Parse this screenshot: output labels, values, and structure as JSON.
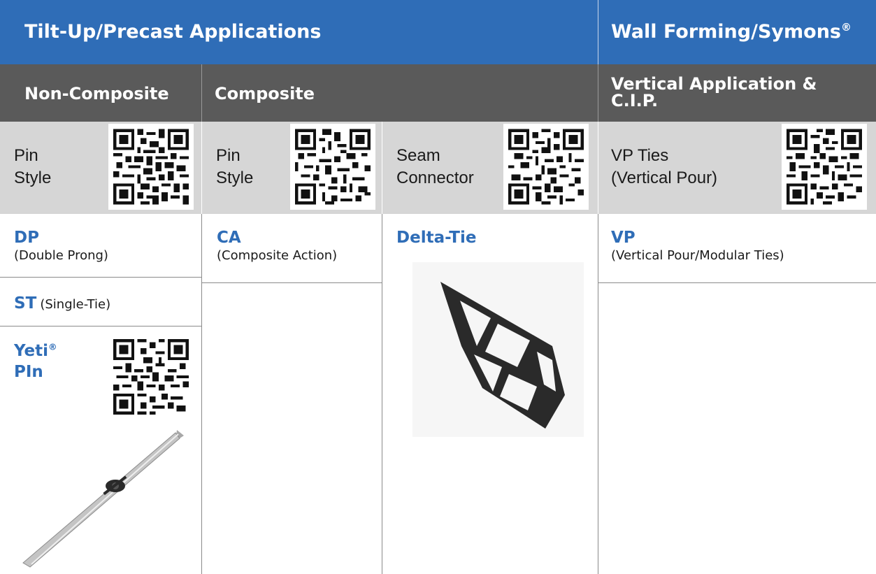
{
  "header": {
    "tiltup_title": "Tilt-Up/Precast Applications",
    "wallforming_title": "Wall Forming/Symons",
    "wallforming_reg": "®"
  },
  "subheader": {
    "noncomposite": "Non-Composite",
    "composite": "Composite",
    "vertical_line1": "Vertical Application &",
    "vertical_line2": "C.I.P."
  },
  "styles": {
    "col1_line1": "Pin",
    "col1_line2": "Style",
    "col2_line1": "Pin",
    "col2_line2": "Style",
    "col3_line1": "Seam",
    "col3_line2": "Connector",
    "col4_line1": "VP Ties",
    "col4_line2": "(Vertical Pour)"
  },
  "products": {
    "dp_code": "DP",
    "dp_desc": "(Double Prong)",
    "ca_code": "CA",
    "ca_desc": "(Composite Action)",
    "delta_code": "Delta-Tie",
    "vp_code": "VP",
    "vp_desc": "(Vertical Pour/Modular Ties)",
    "st_code": "ST",
    "st_desc": "(Single-Tie)",
    "yeti_line1": "Yeti",
    "yeti_reg": "®",
    "yeti_line2": "PIn"
  },
  "colors": {
    "header_blue": "#2f6db7",
    "subheader_gray": "#5a5a5a",
    "style_gray": "#d6d6d6",
    "product_blue": "#2f6db7"
  }
}
